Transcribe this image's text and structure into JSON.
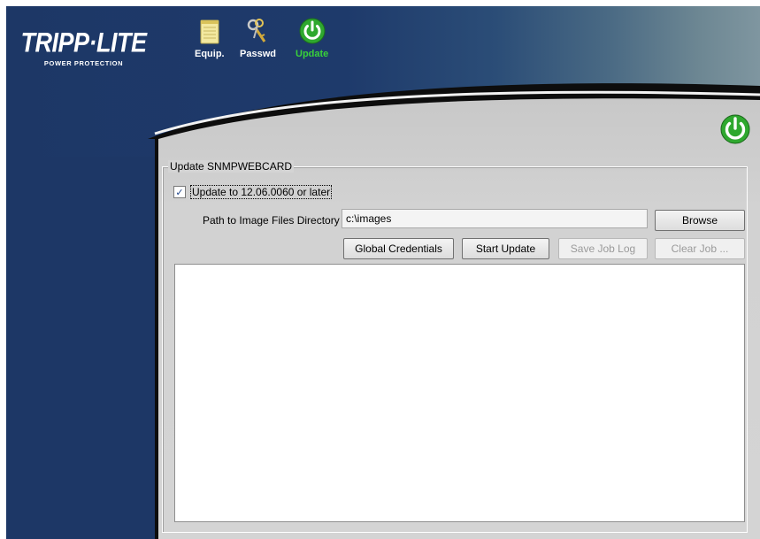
{
  "brand": {
    "logo_text": "TRIPP·LITE",
    "logo_tagline": "POWER PROTECTION"
  },
  "nav": {
    "items": [
      {
        "label": "Equip.",
        "icon": "notepad-icon",
        "active": false
      },
      {
        "label": "Passwd",
        "icon": "keys-icon",
        "active": false
      },
      {
        "label": "Update",
        "icon": "power-icon",
        "active": true
      }
    ]
  },
  "update_panel": {
    "group_title": "Update SNMPWEBCARD",
    "checkbox_label": "Update to 12.06.0060 or later",
    "checkbox_checked": true,
    "path_label": "Path to Image Files Directory",
    "path_value": "c:\\images",
    "buttons": {
      "browse": "Browse",
      "global_credentials": "Global Credentials",
      "start_update": "Start Update",
      "save_job_log": "Save Job Log",
      "clear_job": "Clear Job ..."
    }
  },
  "colors": {
    "sidebar_blue": "#1d3766",
    "panel_gray": "#d4d4d4",
    "active_green": "#39d13a"
  }
}
